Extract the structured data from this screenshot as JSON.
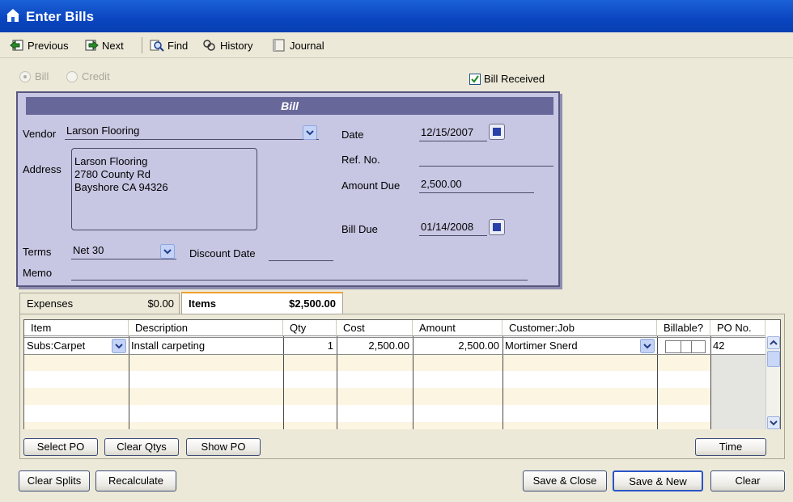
{
  "window": {
    "title": "Enter Bills"
  },
  "toolbar": {
    "previous": "Previous",
    "next": "Next",
    "find": "Find",
    "history": "History",
    "journal": "Journal"
  },
  "type": {
    "bill": "Bill",
    "credit": "Credit",
    "bill_received": "Bill Received",
    "bill_received_checked": true
  },
  "bill": {
    "header": "Bill",
    "vendor_label": "Vendor",
    "vendor": "Larson Flooring",
    "address_label": "Address",
    "address": [
      "Larson Flooring",
      "2780 County Rd",
      "Bayshore CA 94326"
    ],
    "date_label": "Date",
    "date": "12/15/2007",
    "ref_label": "Ref. No.",
    "ref": "",
    "amount_due_label": "Amount Due",
    "amount_due": "2,500.00",
    "bill_due_label": "Bill Due",
    "bill_due": "01/14/2008",
    "terms_label": "Terms",
    "terms": "Net 30",
    "discount_date_label": "Discount Date",
    "discount_date": "",
    "memo_label": "Memo",
    "memo": ""
  },
  "tabs": [
    {
      "label": "Expenses",
      "amount": "$0.00"
    },
    {
      "label": "Items",
      "amount": "$2,500.00"
    }
  ],
  "grid": {
    "columns": [
      "Item",
      "Description",
      "Qty",
      "Cost",
      "Amount",
      "Customer:Job",
      "Billable?",
      "PO No."
    ],
    "rows": [
      {
        "item": "Subs:Carpet",
        "description": "Install carpeting",
        "qty": "1",
        "cost": "2,500.00",
        "amount": "2,500.00",
        "customer_job": "Mortimer Snerd",
        "po": "42"
      }
    ]
  },
  "grid_buttons": {
    "select_po": "Select PO",
    "clear_qtys": "Clear Qtys",
    "show_po": "Show PO",
    "time": "Time"
  },
  "footer": {
    "clear_splits": "Clear Splits",
    "recalculate": "Recalculate",
    "save_close": "Save & Close",
    "save_new": "Save & New",
    "clear": "Clear"
  },
  "colors": {
    "titlebar": "#0a45bf",
    "bill_panel": "#c7c6e3",
    "bill_header": "#68679a",
    "row_stripe": "#fbf5e2"
  }
}
